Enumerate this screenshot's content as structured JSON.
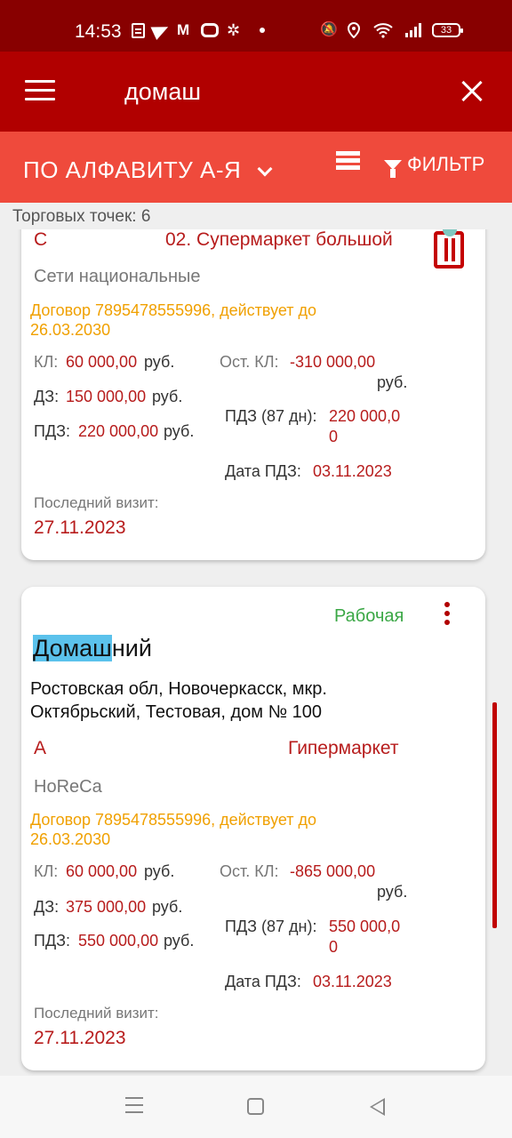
{
  "status_bar": {
    "time": "14:53",
    "battery": "33",
    "icons": [
      "document-icon",
      "telegram-icon",
      "gmail-icon",
      "screen-record-icon",
      "pinwheel-icon",
      "dot-icon",
      "mute-icon",
      "location-icon",
      "wifi-icon",
      "signal-icon",
      "battery-icon"
    ]
  },
  "toolbar": {
    "search_query": "домаш"
  },
  "sort_bar": {
    "sort_label": "ПО АЛФАВИТУ А-Я",
    "filter_label": "ФИЛЬТР"
  },
  "count_label": "Торговых точек: 6",
  "cards": [
    {
      "category": "С",
      "channel": "02. Супермаркет большой",
      "network": "Сети национальные",
      "contract": "Договор 7895478555996, действует до",
      "contract_date": "26.03.2030",
      "kl_label": "КЛ:",
      "kl_value": "60 000,00",
      "rub": "руб.",
      "dz_label": "ДЗ:",
      "dz_value": "150 000,00",
      "pdz_label": "ПДЗ:",
      "pdz_value": "220 000,00",
      "ost_label": "Ост. КЛ:",
      "ost_value": "-310 000,00",
      "pdz87_label": "ПДЗ (87 дн):",
      "pdz87_value_1": "220 000,0",
      "pdz87_value_2": "0",
      "date_pdz_label": "Дата ПДЗ:",
      "date_pdz_value": "03.11.2023",
      "last_visit_label": "Последний визит:",
      "last_visit_value": "27.11.2023"
    },
    {
      "status": "Рабочая",
      "name_highlight": "Домаш",
      "name_rest": "ний",
      "address_line1": "Ростовская обл, Новочеркасск, мкр.",
      "address_line2": "Октябрьский, Тестовая, дом № 100",
      "category": "А",
      "channel": "Гипермаркет",
      "network": "HoReCa",
      "contract": "Договор 7895478555996, действует до",
      "contract_date": "26.03.2030",
      "kl_label": "КЛ:",
      "kl_value": "60 000,00",
      "rub": "руб.",
      "dz_label": "ДЗ:",
      "dz_value": "375 000,00",
      "pdz_label": "ПДЗ:",
      "pdz_value": "550 000,00",
      "ost_label": "Ост. КЛ:",
      "ost_value": "-865 000,00",
      "pdz87_label": "ПДЗ (87 дн):",
      "pdz87_value_1": "550 000,0",
      "pdz87_value_2": "0",
      "date_pdz_label": "Дата ПДЗ:",
      "date_pdz_value": "03.11.2023",
      "last_visit_label": "Последний визит:",
      "last_visit_value": "27.11.2023"
    }
  ],
  "colors": {
    "status_bar": "#880000",
    "toolbar": "#b10000",
    "sort_bar": "#ef4a3c",
    "accent_red": "#b71c1c",
    "contract_orange": "#f0a000",
    "status_green": "#3aa745",
    "highlight": "#5bc2ec"
  }
}
